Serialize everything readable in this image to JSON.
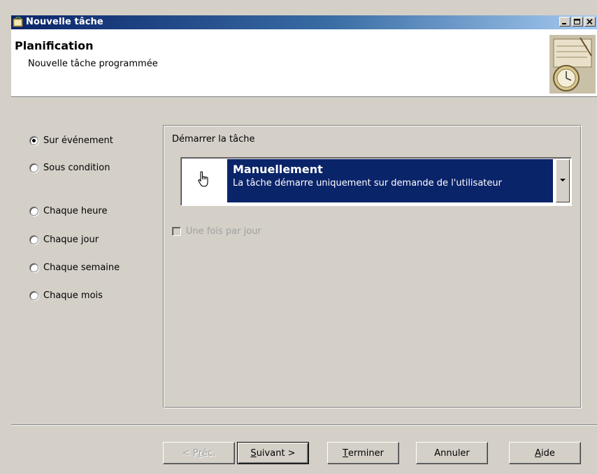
{
  "window": {
    "title": "Nouvelle tâche"
  },
  "header": {
    "title": "Planification",
    "subtitle": "Nouvelle tâche programmée"
  },
  "schedule_options": [
    {
      "label": "Sur événement",
      "checked": true
    },
    {
      "label": "Sous condition",
      "checked": false
    },
    {
      "label": "Chaque heure",
      "checked": false
    },
    {
      "label": "Chaque jour",
      "checked": false
    },
    {
      "label": "Chaque semaine",
      "checked": false
    },
    {
      "label": "Chaque mois",
      "checked": false
    }
  ],
  "start_group": {
    "label": "Démarrer la tâche",
    "selected_title": "Manuellement",
    "selected_description": "La tâche démarre uniquement sur demande de l'utilisateur",
    "icon": "hand-pointer-icon"
  },
  "once_per_day": {
    "label": "Une fois par jour",
    "checked": false,
    "enabled": false
  },
  "buttons": {
    "prev": {
      "prefix": "< P",
      "accel": "r",
      "suffix": "éc.",
      "enabled": false
    },
    "next": {
      "accel": "S",
      "rest": "uivant >"
    },
    "finish": {
      "accel": "T",
      "rest": "erminer"
    },
    "cancel": "Annuler",
    "help": {
      "accel": "A",
      "rest": "ide"
    }
  }
}
